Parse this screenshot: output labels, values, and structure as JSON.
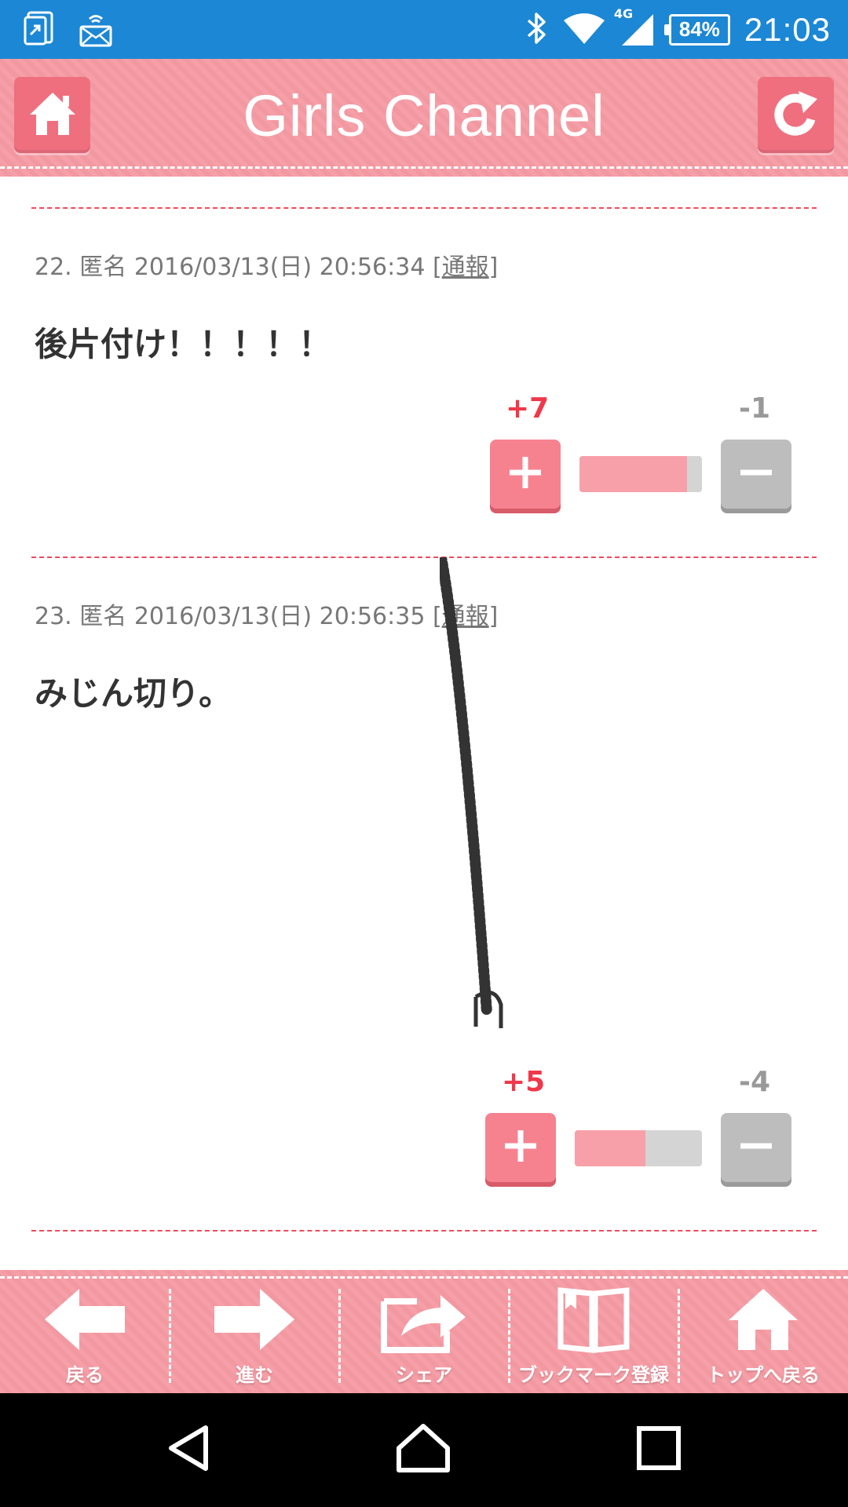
{
  "status_bar": {
    "time": "21:03",
    "battery": "84%",
    "network_label": "4G",
    "icons": [
      "screen-mirror-icon",
      "wifi-display-icon",
      "bluetooth-icon",
      "wifi-icon",
      "signal-icon",
      "battery-icon"
    ]
  },
  "header": {
    "title": "Girls Channel",
    "home_icon": "home-icon",
    "reload_icon": "reload-icon"
  },
  "comments": [
    {
      "number": "22.",
      "author": "匿名",
      "datetime": "2016/03/13(日) 20:56:34",
      "report_open": "[",
      "report_label": "通報",
      "report_close": "]",
      "body": "後片付け！！！！！",
      "plus_count": "+7",
      "minus_count": "-1",
      "plus_share": 0.875
    },
    {
      "number": "23.",
      "author": "匿名",
      "datetime": "2016/03/13(日) 20:56:35",
      "report_open": "[",
      "report_label": "通報",
      "report_close": "]",
      "body": "みじん切り。",
      "plus_count": "+5",
      "minus_count": "-4",
      "plus_share": 0.556
    }
  ],
  "toolbar": {
    "items": [
      {
        "label": "戻る",
        "icon": "arrow-left-icon"
      },
      {
        "label": "進む",
        "icon": "arrow-right-icon"
      },
      {
        "label": "シェア",
        "icon": "share-icon"
      },
      {
        "label": "ブックマーク登録",
        "icon": "bookmark-icon"
      },
      {
        "label": "トップへ戻る",
        "icon": "home-icon"
      }
    ]
  },
  "nav_bar": {
    "icons": [
      "back-icon",
      "home-icon",
      "recents-icon"
    ]
  },
  "colors": {
    "status_bar": "#1c87d4",
    "header": "#f59aa3",
    "plus": "#f0384a",
    "divider": "#f04a5a"
  }
}
